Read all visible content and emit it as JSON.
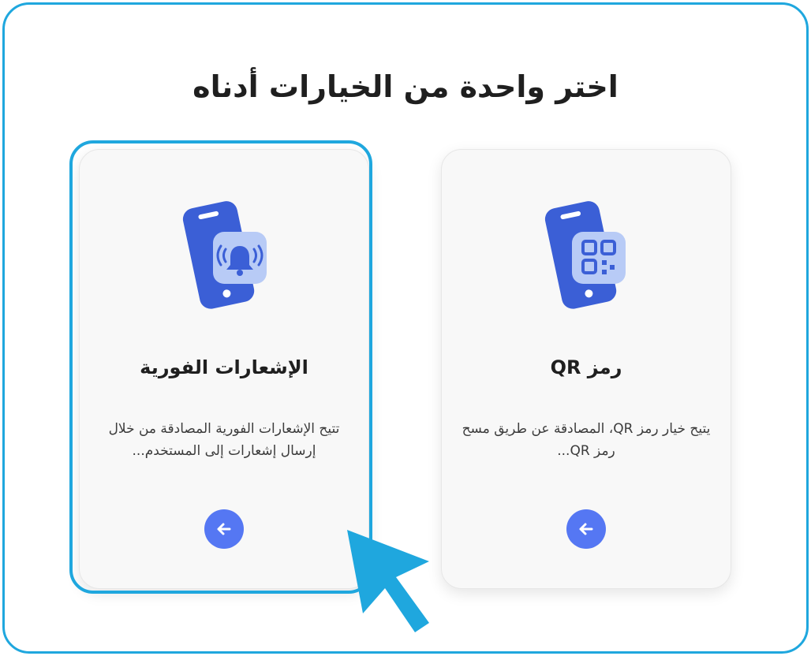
{
  "page": {
    "title": "اختر واحدة من الخيارات أدناه"
  },
  "options": [
    {
      "title": "الإشعارات الفورية",
      "description": "تتيح الإشعارات الفورية المصادقة من خلال إرسال إشعارات إلى المستخدم...",
      "icon": "phone-bell-icon",
      "button_icon": "arrow-left-icon",
      "selected": true
    },
    {
      "title": "رمز QR",
      "description": "يتيح خيار رمز QR، المصادقة عن طريق مسح رمز QR...",
      "icon": "phone-qr-icon",
      "button_icon": "arrow-left-icon",
      "selected": false
    }
  ],
  "colors": {
    "accent": "#1fa7de",
    "phone": "#3b5fd6",
    "phone_badge": "#b8cbf6",
    "button": "#5577f3"
  }
}
